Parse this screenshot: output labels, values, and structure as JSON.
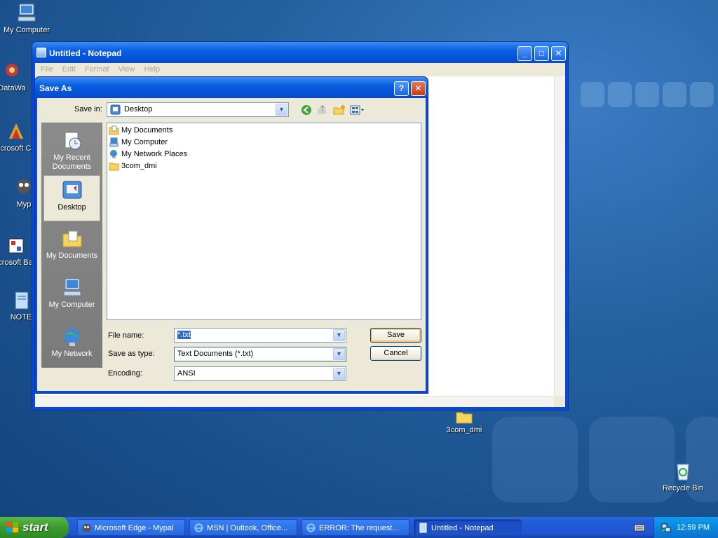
{
  "desktop": {
    "icons": [
      {
        "label": "My Computer"
      },
      {
        "label": "DataWa"
      },
      {
        "label": "Microsoft C++"
      },
      {
        "label": "Myp"
      },
      {
        "label": "Microsoft Basic"
      },
      {
        "label": "NOTE"
      },
      {
        "label": "3com_dmi"
      },
      {
        "label": "Recycle Bin"
      }
    ]
  },
  "notepad": {
    "title": "Untitled - Notepad",
    "menu": [
      "File",
      "Edit",
      "Format",
      "View",
      "Help"
    ],
    "controls": {
      "minimize": "_",
      "maximize": "□",
      "close": "✕"
    }
  },
  "save_dialog": {
    "title": "Save As",
    "help": "?",
    "close": "✕",
    "save_in_label": "Save in:",
    "save_in_value": "Desktop",
    "places": [
      {
        "label": "My Recent Documents"
      },
      {
        "label": "Desktop"
      },
      {
        "label": "My Documents"
      },
      {
        "label": "My Computer"
      },
      {
        "label": "My Network"
      }
    ],
    "files": [
      {
        "name": "My Documents"
      },
      {
        "name": "My Computer"
      },
      {
        "name": "My Network Places"
      },
      {
        "name": "3com_dmi"
      }
    ],
    "file_name_label": "File name:",
    "file_name_value": "*.txt",
    "save_type_label": "Save as type:",
    "save_type_value": "Text Documents (*.txt)",
    "encoding_label": "Encoding:",
    "encoding_value": "ANSI",
    "save_button": "Save",
    "cancel_button": "Cancel"
  },
  "taskbar": {
    "start_label": "start",
    "tasks": [
      {
        "label": "Microsoft Edge - Mypal"
      },
      {
        "label": "MSN | Outlook, Office..."
      },
      {
        "label": "ERROR: The request..."
      },
      {
        "label": "Untitled - Notepad"
      }
    ],
    "clock": "12:59 PM"
  },
  "colors": {
    "titlebar": "#0a5fe0",
    "dialog_face": "#ece9d8",
    "taskbar": "#245edb",
    "start_green": "#3a9a2e"
  }
}
